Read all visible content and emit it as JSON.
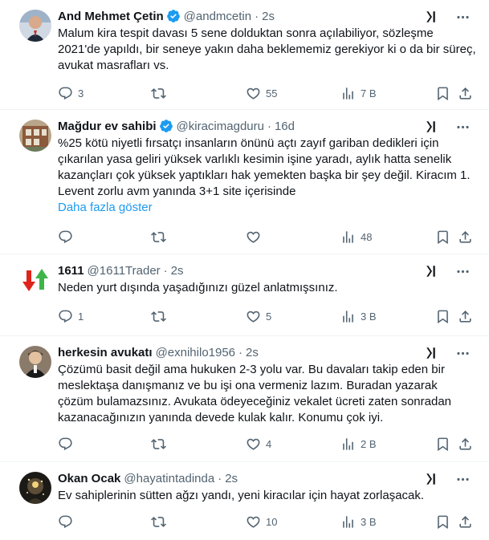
{
  "colors": {
    "accent": "#1d9bf0",
    "muted": "#536471",
    "verified": "#1d9bf0"
  },
  "tweets": [
    {
      "name": "And Mehmet Çetin",
      "verified": true,
      "handle": "@andmcetin",
      "time": "2s",
      "text": "Malum kira tespit davası 5 sene dolduktan sonra açılabiliyor, sözleşme 2021'de yapıldı, bir seneye yakın daha beklememiz gerekiyor ki o da bir süreç, avukat masrafları vs.",
      "show_more": "",
      "replies": "3",
      "retweets": "",
      "likes": "55",
      "views": "7 B"
    },
    {
      "name": "Mağdur ev sahibi",
      "verified": true,
      "handle": "@kiracimagduru",
      "time": "16d",
      "text": "%25 kötü niyetli fırsatçı insanların önünü açtı zayıf gariban dedikleri için çıkarılan yasa geliri yüksek varlıklı kesimin işine yaradı, aylık hatta senelik kazançları çok yüksek yaptıkları hak yemekten başka bir şey değil. Kiracım 1. Levent zorlu avm yanında 3+1 site içerisinde",
      "show_more": "Daha fazla göster",
      "replies": "",
      "retweets": "",
      "likes": "",
      "views": "48"
    },
    {
      "name": "1611",
      "verified": false,
      "handle": "@1611Trader",
      "time": "2s",
      "text": "Neden yurt dışında yaşadığınızı güzel anlatmışsınız.",
      "show_more": "",
      "replies": "1",
      "retweets": "",
      "likes": "5",
      "views": "3 B"
    },
    {
      "name": "herkesin avukatı",
      "verified": false,
      "handle": "@exnihilo1956",
      "time": "2s",
      "text": "Çözümü basit değil ama hukuken 2-3 yolu var. Bu davaları takip eden bir meslektaşa danışmanız ve bu işi ona vermeniz lazım. Buradan yazarak çözüm bulamazsınız. Avukata ödeyeceğiniz vekalet ücreti zaten sonradan kazanacağınızın yanında devede kulak kalır. Konumu çok iyi.",
      "show_more": "",
      "replies": "",
      "retweets": "",
      "likes": "4",
      "views": "2 B"
    },
    {
      "name": "Okan Ocak",
      "verified": false,
      "handle": "@hayatintadinda",
      "time": "2s",
      "text": "Ev sahiplerinin sütten ağzı yandı, yeni kiracılar için hayat zorlaşacak.",
      "show_more": "",
      "replies": "",
      "retweets": "",
      "likes": "10",
      "views": "3 B"
    }
  ]
}
